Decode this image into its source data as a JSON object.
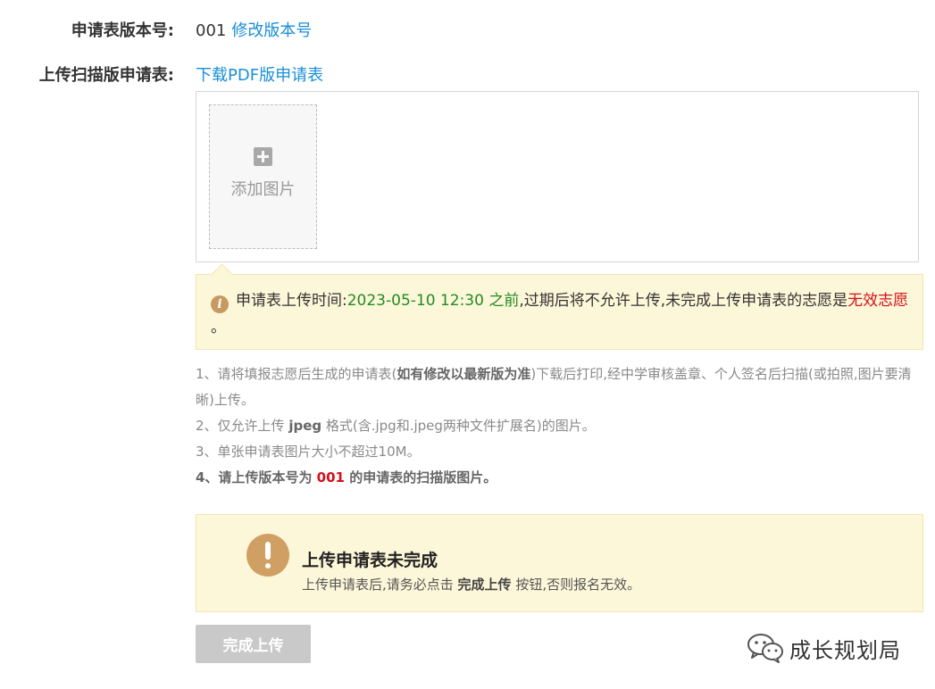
{
  "version_row": {
    "label": "申请表版本号:",
    "value": "001",
    "modify_link": "修改版本号"
  },
  "upload_row": {
    "label": "上传扫描版申请表:",
    "download_link": "下载PDF版申请表"
  },
  "upload_box": {
    "add_image_label": "添加图片"
  },
  "notice": {
    "prefix": "申请表上传时间:",
    "deadline": "2023-05-10 12:30 之前",
    "middle": ",过期后将不允许上传,未完成上传申请表的志愿是",
    "invalid": "无效志愿",
    "suffix": " 。"
  },
  "rules": {
    "r1_pre": "1、请将填报志愿后生成的申请表(",
    "r1_bold": "如有修改以最新版为准",
    "r1_post": ")下载后打印,经中学审核盖章、个人签名后扫描(或拍照,图片要清晰)上传。",
    "r2_pre": "2、仅允许上传 ",
    "r2_bold": "jpeg",
    "r2_post": " 格式(含.jpg和.jpeg两种文件扩展名)的图片。",
    "r3": "3、单张申请表图片大小不超过10M。",
    "r4_pre": "4、请上传版本号为 ",
    "r4_num": "001",
    "r4_post": " 的申请表的扫描版图片。"
  },
  "warning": {
    "title": "上传申请表未完成",
    "sub_pre": "上传申请表后,请务必点击 ",
    "sub_bold": "完成上传",
    "sub_post": " 按钮,否则报名无效。"
  },
  "actions": {
    "complete_label": "完成上传"
  },
  "watermark": {
    "text": "成长规划局",
    "icon": "wechat-icon"
  },
  "colors": {
    "link": "#1a8fd6",
    "deadline": "#228b22",
    "invalid": "#d4101a",
    "notice_bg": "#fdf7d9",
    "warn_icon": "#cf9f64",
    "button_disabled": "#c9c9c9"
  }
}
